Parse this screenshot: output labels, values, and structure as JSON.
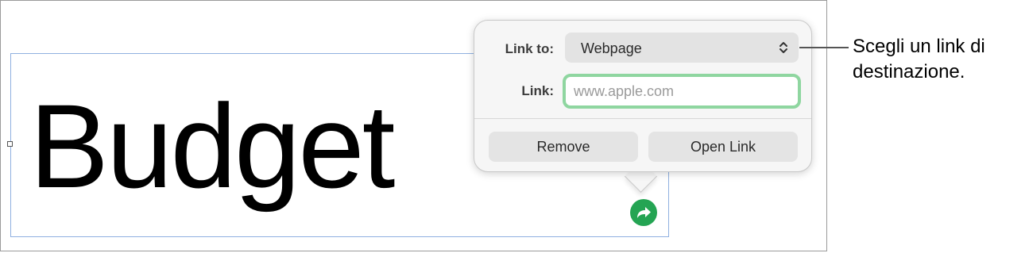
{
  "slide": {
    "text_box": {
      "text": "Budget"
    }
  },
  "link_popover": {
    "link_to_label": "Link to:",
    "link_to_value": "Webpage",
    "link_label": "Link:",
    "link_value": "",
    "link_placeholder": "www.apple.com",
    "remove_button": "Remove",
    "open_link_button": "Open Link"
  },
  "annotation": {
    "callout": "Scegli un link di\ndestinazione."
  },
  "colors": {
    "link_badge": "#24a453",
    "focus_ring": "#8fd6a0",
    "selection_border": "#8fb0e0"
  },
  "icons": {
    "link_badge": "link-arrow-icon",
    "select_chevron": "chevron-updown-icon"
  }
}
